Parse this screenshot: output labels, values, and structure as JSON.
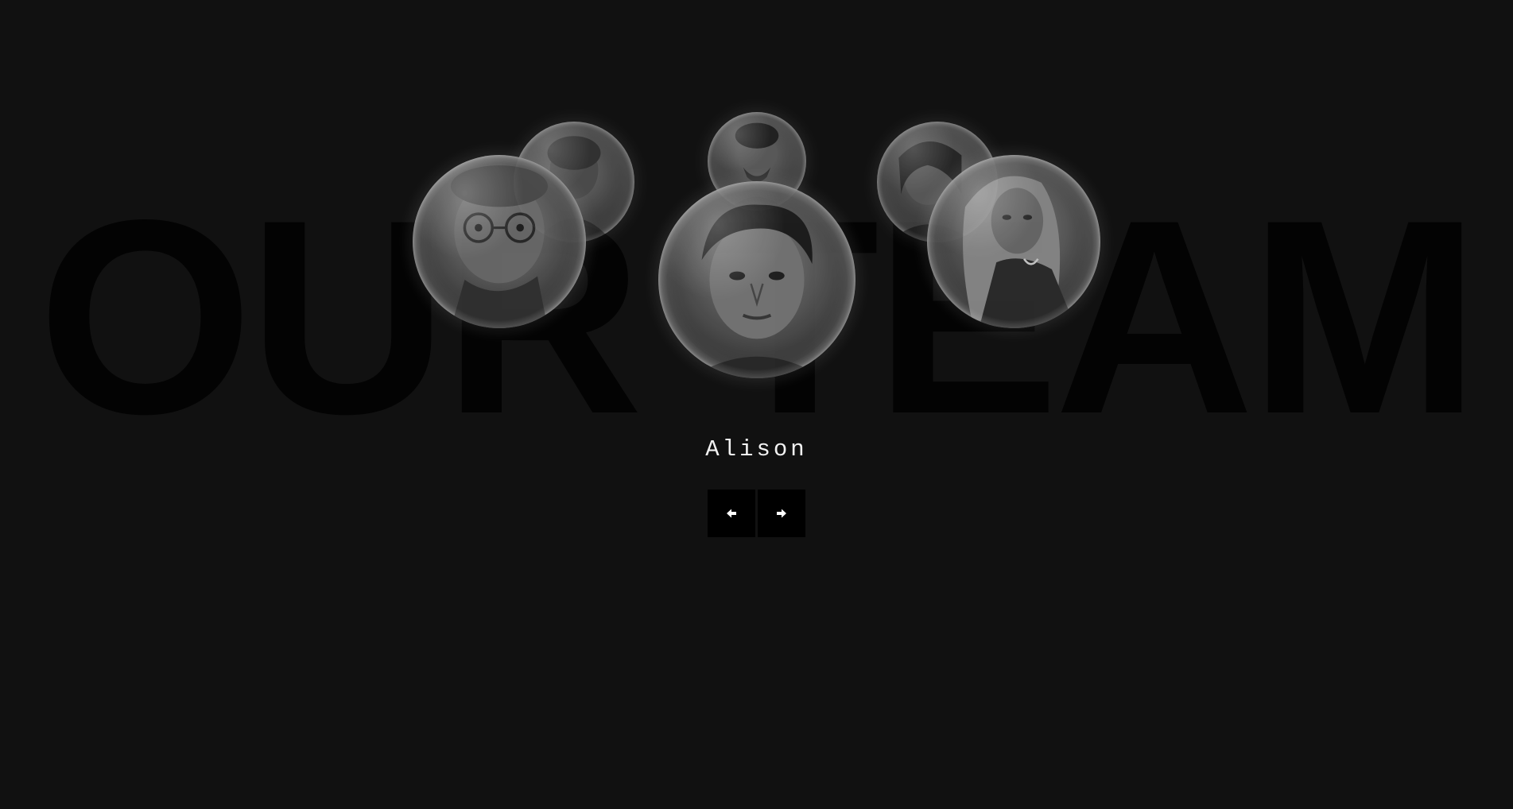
{
  "section": {
    "background_title": "OUR TEAM"
  },
  "team": {
    "members": [
      {
        "icon": "portrait-photo",
        "description_name": "member-1"
      },
      {
        "icon": "portrait-photo",
        "description_name": "member-2"
      },
      {
        "icon": "portrait-photo",
        "description_name": "member-3"
      },
      {
        "icon": "portrait-photo",
        "description_name": "member-4"
      },
      {
        "icon": "portrait-photo",
        "description_name": "member-5"
      },
      {
        "icon": "portrait-photo",
        "description_name": "member-6"
      }
    ],
    "active_name": "Alison"
  },
  "navigation": {
    "prev_icon": "arrow-left-icon",
    "next_icon": "arrow-right-icon"
  },
  "colors": {
    "background": "#111111",
    "title_text": "#030303",
    "name_text": "#f2f2f2",
    "button_bg": "#000000"
  }
}
